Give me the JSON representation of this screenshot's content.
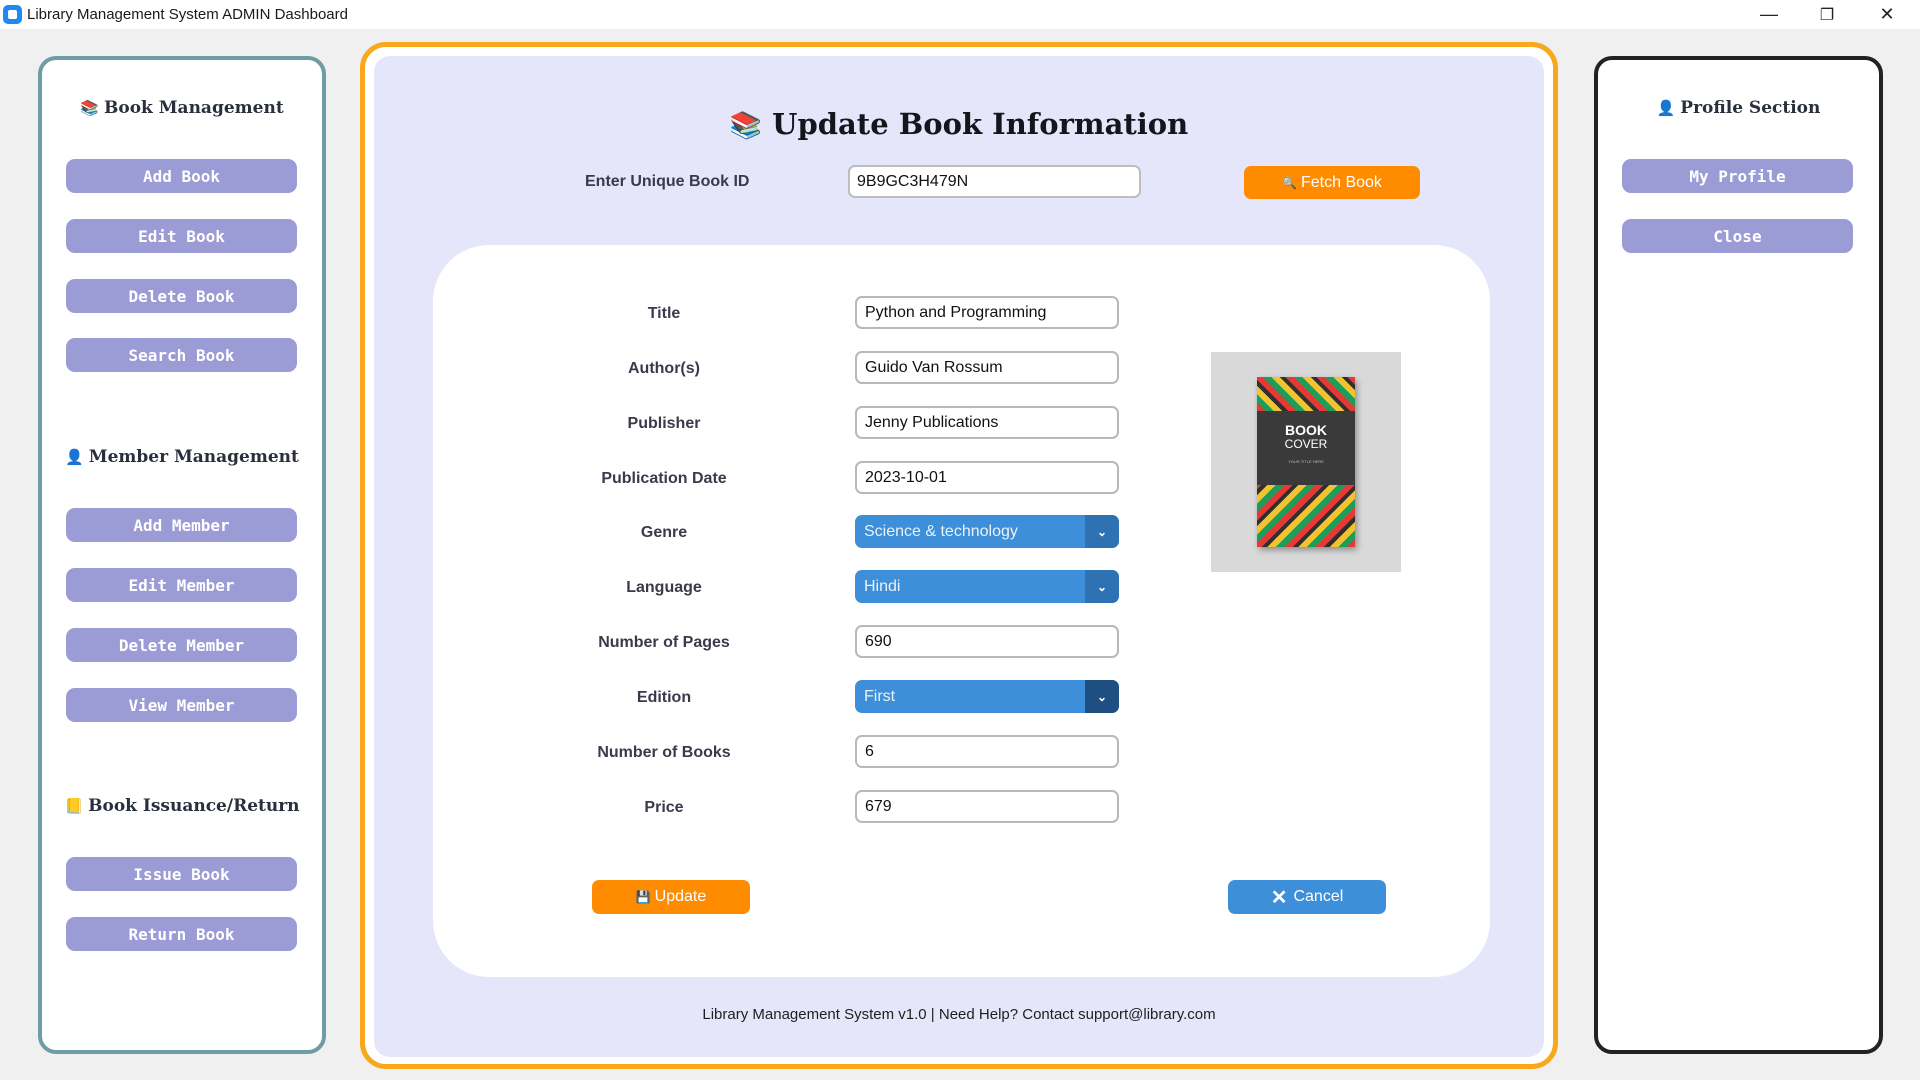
{
  "window": {
    "title": "Library Management System ADMIN Dashboard",
    "controls": {
      "minimize": "—",
      "restore": "❐",
      "close": "✕"
    }
  },
  "left_sidebar": {
    "sections": [
      {
        "title": "Book Management",
        "icon": "books-icon",
        "icon_glyph": "📚",
        "buttons": [
          "Add Book",
          "Edit Book",
          "Delete Book",
          "Search Book"
        ]
      },
      {
        "title": "Member Management",
        "icon": "person-icon",
        "icon_glyph": "👤",
        "buttons": [
          "Add Member",
          "Edit Member",
          "Delete Member",
          "View Member"
        ]
      },
      {
        "title": "Book Issuance/Return",
        "icon": "ledger-icon",
        "icon_glyph": "📒",
        "buttons": [
          "Issue Book",
          "Return Book"
        ]
      }
    ]
  },
  "right_sidebar": {
    "title": "Profile Section",
    "icon": "person-icon",
    "icon_glyph": "👤",
    "buttons": [
      "My Profile",
      "Close"
    ]
  },
  "main": {
    "title": "Update Book Information",
    "title_icon": "books-icon",
    "title_icon_glyph": "📚",
    "book_id_label": "Enter Unique Book ID",
    "book_id_value": "9B9GC3H479N",
    "fetch_button": {
      "label": "Fetch Book",
      "icon": "search-icon",
      "icon_glyph": "🔍"
    },
    "fields": {
      "title": {
        "label": "Title",
        "value": "Python and Programming"
      },
      "authors": {
        "label": "Author(s)",
        "value": "Guido Van Rossum"
      },
      "publisher": {
        "label": "Publisher",
        "value": "Jenny Publications"
      },
      "publication_date": {
        "label": "Publication Date",
        "value": "2023-10-01"
      },
      "genre": {
        "label": "Genre",
        "value": "Science & technology"
      },
      "language": {
        "label": "Language",
        "value": "Hindi"
      },
      "pages": {
        "label": "Number of Pages",
        "value": "690"
      },
      "edition": {
        "label": "Edition",
        "value": "First"
      },
      "num_books": {
        "label": "Number of Books",
        "value": "6"
      },
      "price": {
        "label": "Price",
        "value": "679"
      }
    },
    "cover": {
      "line1": "BOOK",
      "line2": "COVER",
      "line3": "YOUR TITLE HERE"
    },
    "update_button": {
      "label": "Update",
      "icon": "save-icon",
      "icon_glyph": "💾"
    },
    "cancel_button": {
      "label": "Cancel",
      "icon": "close-icon",
      "icon_glyph": "✕"
    },
    "footer": "Library Management System v1.0 | Need Help? Contact support@library.com"
  },
  "colors": {
    "accent_orange": "#ff8c00",
    "side_button": "#9b9bd6",
    "select_blue": "#3c8fd8",
    "panel_bg": "#e6e6fa",
    "main_border": "#f7a81b",
    "left_border": "#6f9da3"
  }
}
